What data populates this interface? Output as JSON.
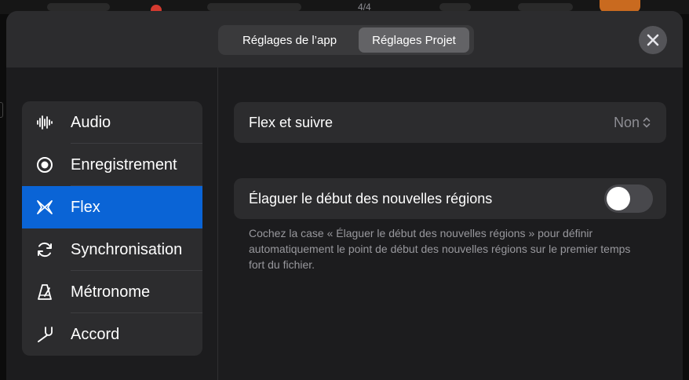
{
  "segments": {
    "app": "Réglages de l’app",
    "project": "Réglages Projet",
    "selected": "project"
  },
  "background": {
    "time_signature": "4/4"
  },
  "sidebar": {
    "items": [
      {
        "label": "Audio",
        "icon": "waveform-icon",
        "selected": false
      },
      {
        "label": "Enregistrement",
        "icon": "record-icon",
        "selected": false
      },
      {
        "label": "Flex",
        "icon": "flex-icon",
        "selected": true
      },
      {
        "label": "Synchronisation",
        "icon": "sync-icon",
        "selected": false
      },
      {
        "label": "Métronome",
        "icon": "metronome-icon",
        "selected": false
      },
      {
        "label": "Accord",
        "icon": "tuning-fork-icon",
        "selected": false
      }
    ]
  },
  "flex": {
    "follow_label": "Flex et suivre",
    "follow_value": "Non",
    "trim_label": "Élaguer le début des nouvelles régions",
    "trim_on": false,
    "help_text": "Cochez la case « Élaguer le début des nouvelles régions » pour définir automatiquement le point de début des nouvelles régions sur le premier temps fort du fichier."
  },
  "colors": {
    "accent": "#0a64d6",
    "sheet": "#1c1c1e",
    "card": "#2c2c2e",
    "muted": "#98989d"
  }
}
